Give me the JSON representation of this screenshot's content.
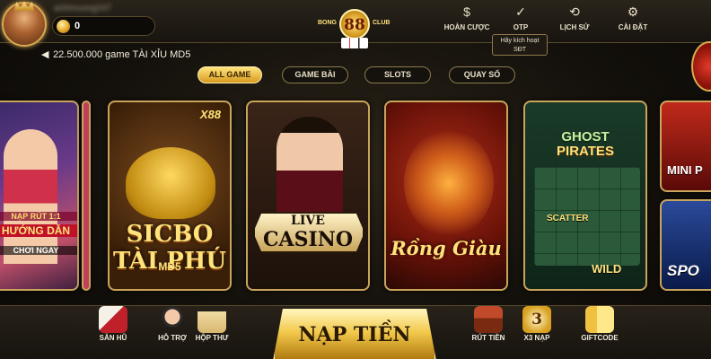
{
  "header": {
    "balance": "0",
    "logo": {
      "left": "BONG",
      "number": "88",
      "right": "CLUB"
    }
  },
  "nav": [
    {
      "label": "HOÀN CƯỢC",
      "icon": "dollar-icon",
      "glyph": "$"
    },
    {
      "label": "OTP",
      "icon": "shield-check-icon",
      "glyph": "✓"
    },
    {
      "label": "LỊCH SỬ",
      "icon": "history-icon",
      "glyph": "⟲"
    },
    {
      "label": "CÀI ĐẶT",
      "icon": "gear-icon",
      "glyph": "⚙"
    }
  ],
  "tooltip": {
    "line1": "Hãy kích hoạt",
    "line2": "SĐT"
  },
  "marquee": "22.500.000 game TÀI XỈU MD5",
  "tabs": [
    {
      "label": "ALL GAME",
      "active": true
    },
    {
      "label": "GAME BÀI",
      "active": false
    },
    {
      "label": "SLOTS",
      "active": false
    },
    {
      "label": "QUAY SỐ",
      "active": false
    }
  ],
  "games": {
    "promo": {
      "line1": "NẠP RÚT 1:1",
      "line2": "HƯỚNG DẪN",
      "line3": "CHƠI NGAY"
    },
    "sicbo": {
      "badge": "X88",
      "title": "SICBO TÀI PHÚ",
      "subtitle": "MD5"
    },
    "casino": {
      "line1": "LIVE",
      "line2": "CASINO"
    },
    "dragon": {
      "title": "Rồng Giàu"
    },
    "ghost": {
      "line1": "GHOST",
      "line2": "PIRATES",
      "scatter": "SCATTER",
      "wild": "WILD"
    },
    "mini": {
      "title": "MINI P"
    },
    "sport": {
      "title": "SPO"
    }
  },
  "bottom": {
    "left": [
      {
        "label": "SĂN HŨ",
        "icon": "dice-icon"
      },
      {
        "label": "HỖ TRỢ",
        "icon": "support-agent-icon"
      },
      {
        "label": "HỘP THƯ",
        "icon": "mailbox-icon"
      }
    ],
    "deposit": "NẠP TIỀN",
    "right": [
      {
        "label": "RÚT TIỀN",
        "icon": "treasure-chest-icon"
      },
      {
        "label": "X3 NẠP",
        "icon": "x3-badge-icon",
        "glyph": "3"
      },
      {
        "label": "GIFTCODE",
        "icon": "giftcode-ticket-icon"
      }
    ]
  }
}
